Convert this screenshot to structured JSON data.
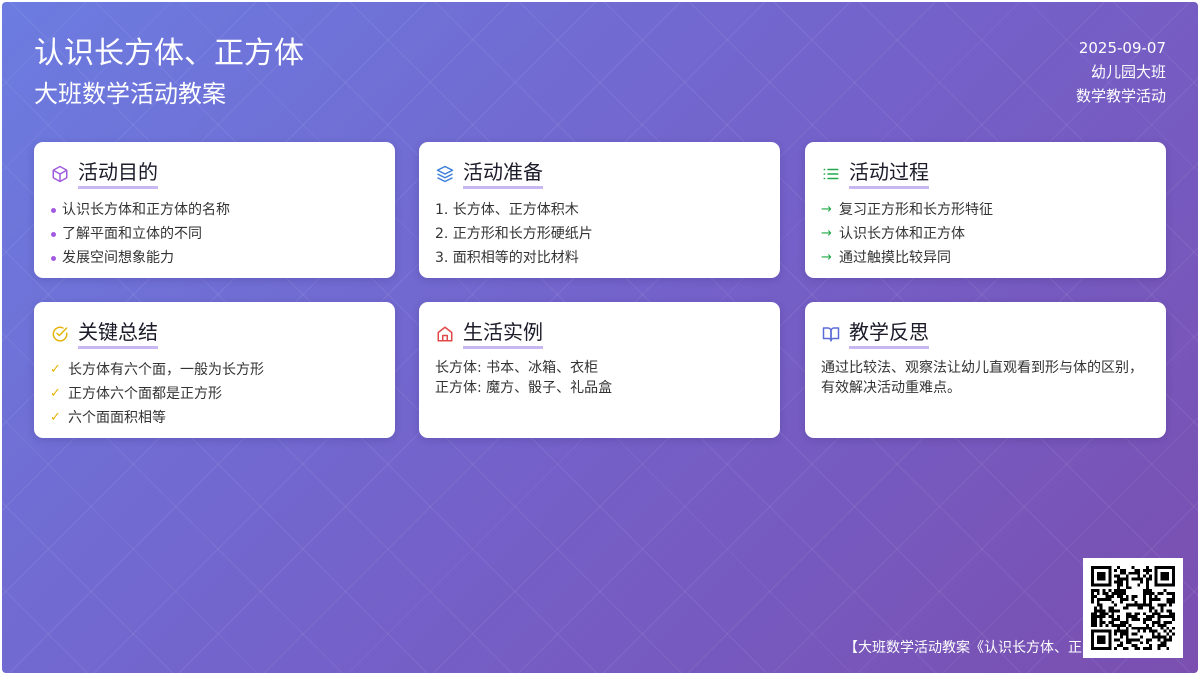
{
  "header": {
    "title": "认识长方体、正方体",
    "subtitle": "大班数学活动教案",
    "date": "2025-09-07",
    "grade": "幼儿园大班",
    "category": "数学教学活动"
  },
  "cards": {
    "goals": {
      "title": "活动目的",
      "icon": "cube-icon",
      "items": [
        "认识长方体和正方体的名称",
        "了解平面和立体的不同",
        "发展空间想象能力"
      ]
    },
    "prep": {
      "title": "活动准备",
      "icon": "layers-icon",
      "items": [
        "1. 长方体、正方体积木",
        "2. 正方形和长方形硬纸片",
        "3. 面积相等的对比材料"
      ]
    },
    "process": {
      "title": "活动过程",
      "icon": "list-icon",
      "items": [
        "复习正方形和长方形特征",
        "认识长方体和正方体",
        "通过触摸比较异同"
      ]
    },
    "summary": {
      "title": "关键总结",
      "icon": "check-circle-icon",
      "items": [
        "长方体有六个面，一般为长方形",
        "正方体六个面都是正方形",
        "六个面面积相等"
      ]
    },
    "examples": {
      "title": "生活实例",
      "icon": "home-icon",
      "items": [
        "长方体: 书本、冰箱、衣柜",
        "正方体: 魔方、骰子、礼品盒"
      ]
    },
    "reflection": {
      "title": "教学反思",
      "icon": "book-open-icon",
      "text": "通过比较法、观察法让幼儿直观看到形与体的区别，有效解决活动重难点。"
    }
  },
  "footer": {
    "text": "【大班数学活动教案《认识长方体、正"
  },
  "colors": {
    "accent_purple": "#a15be0",
    "accent_blue": "#3d7fd9",
    "accent_green": "#22a84a",
    "accent_yellow": "#e4b40a",
    "accent_red": "#e0484a",
    "accent_indigo": "#5b6cd6",
    "title_underline": "#c9b8f0"
  }
}
